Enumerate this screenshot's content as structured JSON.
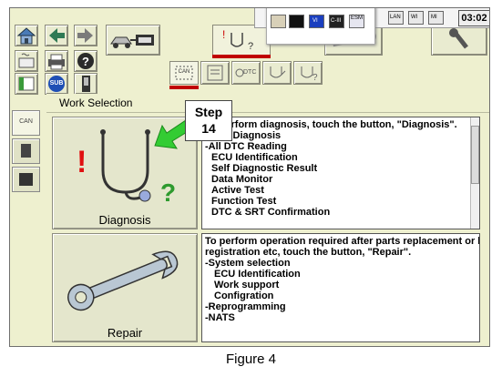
{
  "status_bar": {
    "clock": "03:02",
    "icons": [
      "wrench-icon",
      "screen-icon",
      "vi-icon",
      "cii-icon",
      "esm-icon",
      "power-icon",
      "lan-icon",
      "wi-icon",
      "mi-icon"
    ],
    "vi_label": "VI",
    "cii_label": "C-III",
    "esm_label": "ESM",
    "lan_label": "LAN",
    "wi_label": "WI",
    "mi_label": "MI"
  },
  "toolbar": {
    "sub_label": "SUB",
    "dtc_label": "DTC",
    "can_label": "CAN"
  },
  "section": {
    "title": "Work Selection"
  },
  "sidebar": {
    "can_label": "CAN"
  },
  "diagnosis": {
    "label": "Diagnosis",
    "description": [
      "To perform diagnosis, touch the button, \"Diagnosis\".",
      "-CAN Diagnosis",
      "-All DTC Reading",
      "ECU Identification",
      "Self Diagnostic Result",
      "Data Monitor",
      "Active Test",
      "Function Test",
      "DTC & SRT Confirmation"
    ]
  },
  "repair": {
    "label": "Repair",
    "description": [
      "To perform operation required after parts replacement or key",
      "registration etc, touch the button, \"Repair\".",
      "-System selection",
      "ECU Identification",
      "Work support",
      "Configration",
      "-Reprogramming",
      "-NATS"
    ]
  },
  "callout": {
    "line1": "Step",
    "line2": "14",
    "arrow_color": "#33cc33"
  },
  "caption": "Figure 4",
  "colors": {
    "background": "#eef0cf",
    "accent_red": "#c00000",
    "exclamation_red": "#e01010",
    "question_green": "#2e9a2e"
  }
}
